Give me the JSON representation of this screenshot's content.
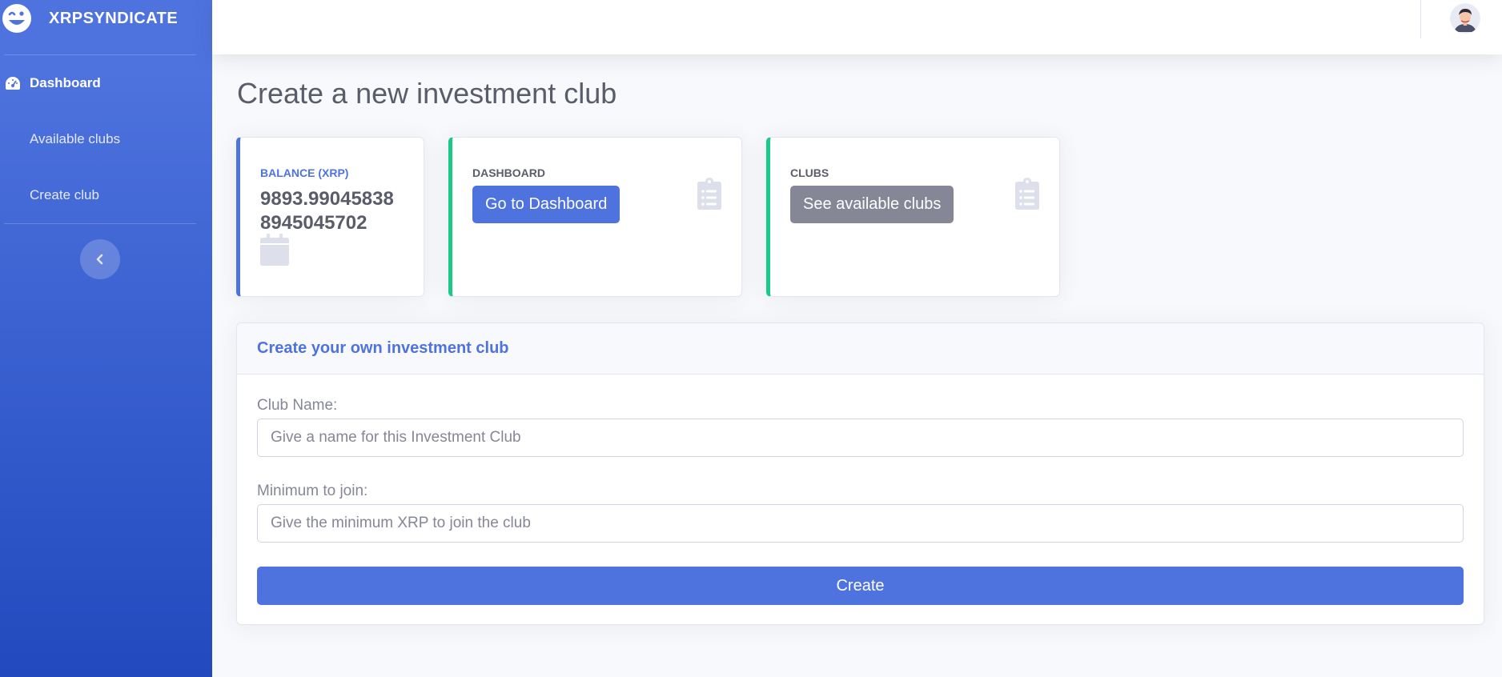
{
  "brand": {
    "name": "XRPSYNDICATE",
    "logo_icon": "laughing-face-icon"
  },
  "sidebar": {
    "items": [
      {
        "label": "Dashboard",
        "icon": "tachometer-icon",
        "active": true
      },
      {
        "label": "Available clubs",
        "icon": "",
        "active": false
      },
      {
        "label": "Create club",
        "icon": "",
        "active": false
      }
    ],
    "toggle_icon": "chevron-left-icon"
  },
  "topbar": {
    "avatar_icon": "user-avatar"
  },
  "page": {
    "title": "Create a new investment club"
  },
  "cards": {
    "balance": {
      "label": "BALANCE (XRP)",
      "value": "9893.990458388945045702",
      "icon": "calendar-icon"
    },
    "dashboard": {
      "label": "DASHBOARD",
      "button": "Go to Dashboard",
      "icon": "clipboard-list-icon"
    },
    "clubs": {
      "label": "CLUBS",
      "button": "See available clubs",
      "icon": "clipboard-list-icon"
    }
  },
  "form": {
    "header": "Create your own investment club",
    "club_name_label": "Club Name:",
    "club_name_placeholder": "Give a name for this Investment Club",
    "club_name_value": "",
    "minimum_label": "Minimum to join:",
    "minimum_placeholder": "Give the minimum XRP to join the club",
    "minimum_value": "",
    "submit": "Create"
  },
  "colors": {
    "primary": "#4e73df",
    "success": "#1cc88a",
    "secondary": "#858796",
    "text": "#5a5c69"
  }
}
